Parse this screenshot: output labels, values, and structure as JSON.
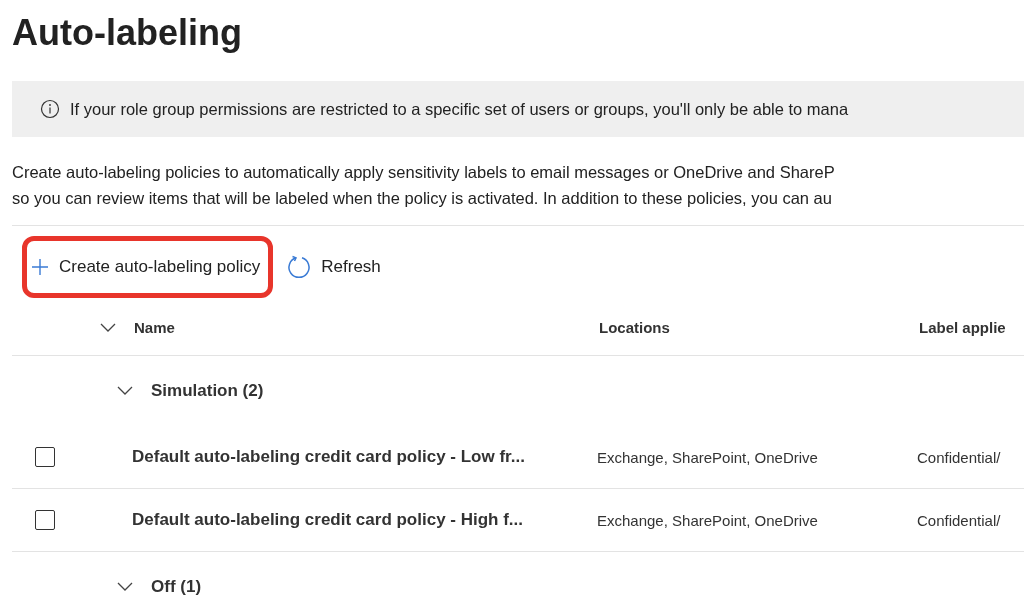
{
  "title": "Auto-labeling",
  "info_bar": {
    "text": "If your role group permissions are restricted to a specific set of users or groups, you'll only be able to mana"
  },
  "description": [
    "Create auto-labeling policies to automatically apply sensitivity labels to email messages or OneDrive and ShareP",
    "so you can review items that will be labeled when the policy is activated. In addition to these policies, you can au"
  ],
  "toolbar": [
    {
      "kind": "create",
      "label": "Create auto-labeling policy",
      "highlighted": true
    },
    {
      "kind": "refresh",
      "label": "Refresh",
      "highlighted": false
    }
  ],
  "table": {
    "columns": [
      "Name",
      "Locations",
      "Label applie"
    ],
    "groups": [
      {
        "label": "Simulation (2)",
        "expanded": true,
        "rows": [
          {
            "name": "Default auto-labeling credit card policy - Low fr...",
            "locations": "Exchange, SharePoint, OneDrive",
            "label": "Confidential/",
            "checked": false
          },
          {
            "name": "Default auto-labeling credit card policy - High f...",
            "locations": "Exchange, SharePoint, OneDrive",
            "label": "Confidential/",
            "checked": false
          }
        ]
      },
      {
        "label": "Off (1)",
        "expanded": true
      }
    ]
  }
}
